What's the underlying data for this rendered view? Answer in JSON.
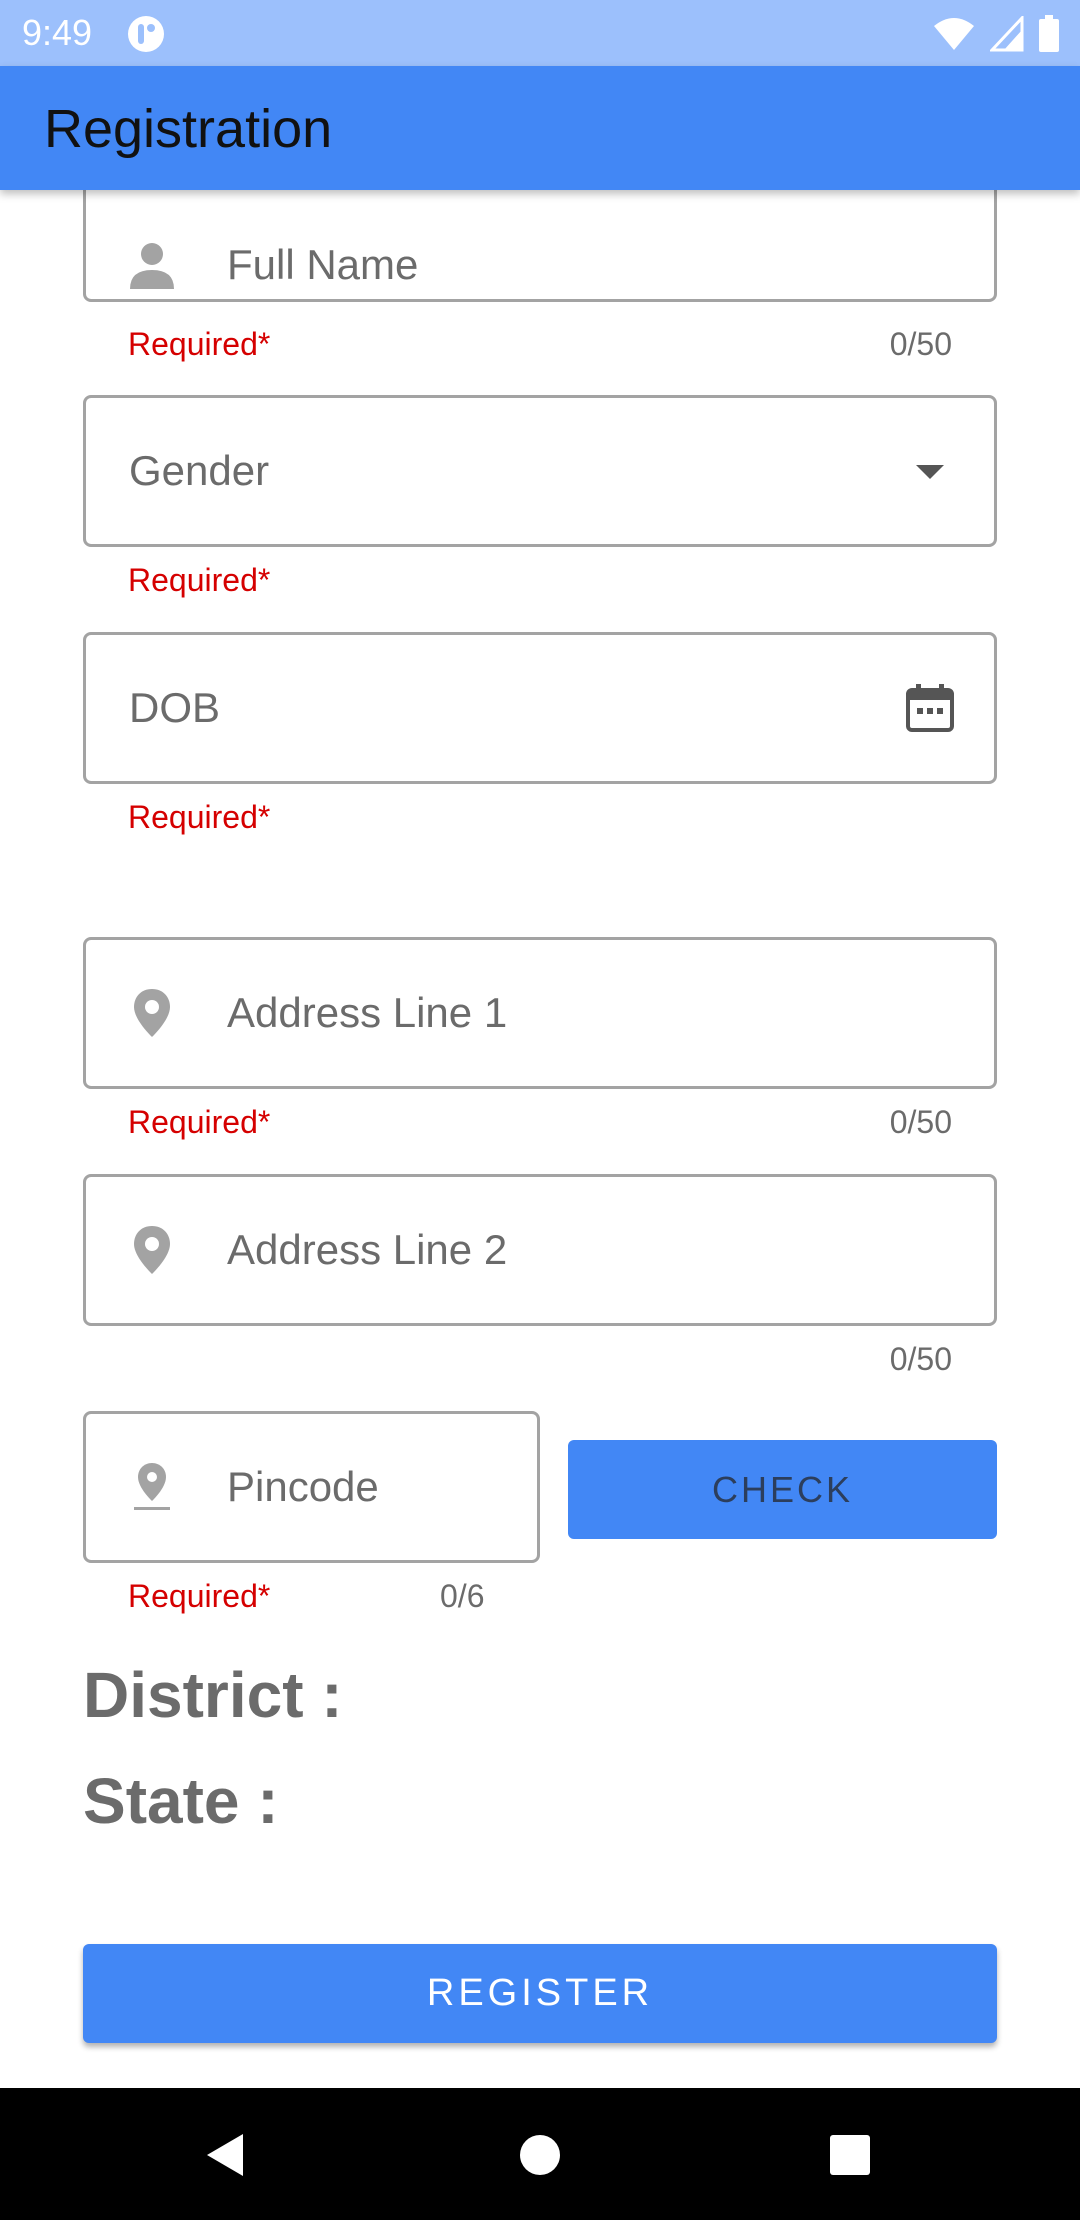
{
  "status_bar": {
    "time": "9:49"
  },
  "app_bar": {
    "title": "Registration"
  },
  "form": {
    "full_name": {
      "placeholder": "Full Name",
      "helper": "Required*",
      "counter": "0/50"
    },
    "gender": {
      "placeholder": "Gender",
      "helper": "Required*"
    },
    "dob": {
      "placeholder": "DOB",
      "helper": "Required*"
    },
    "address1": {
      "placeholder": "Address Line 1",
      "helper": "Required*",
      "counter": "0/50"
    },
    "address2": {
      "placeholder": "Address Line 2",
      "counter": "0/50"
    },
    "pincode": {
      "placeholder": "Pincode",
      "helper": "Required*",
      "counter": "0/6"
    },
    "check_label": "CHECK",
    "district_label": "District :",
    "state_label": "State :",
    "register_label": "REGISTER"
  },
  "icons": {
    "full_name": "person-icon",
    "gender": "dropdown-arrow-icon",
    "dob": "calendar-icon",
    "address": "location-pin-icon",
    "pincode": "location-pin-underline-icon"
  },
  "colors": {
    "primary": "#4287f5",
    "status_bar": "#9cc0fc",
    "error": "#d50000",
    "text_secondary": "#6b6b6b",
    "outline": "#a3a3a3"
  }
}
